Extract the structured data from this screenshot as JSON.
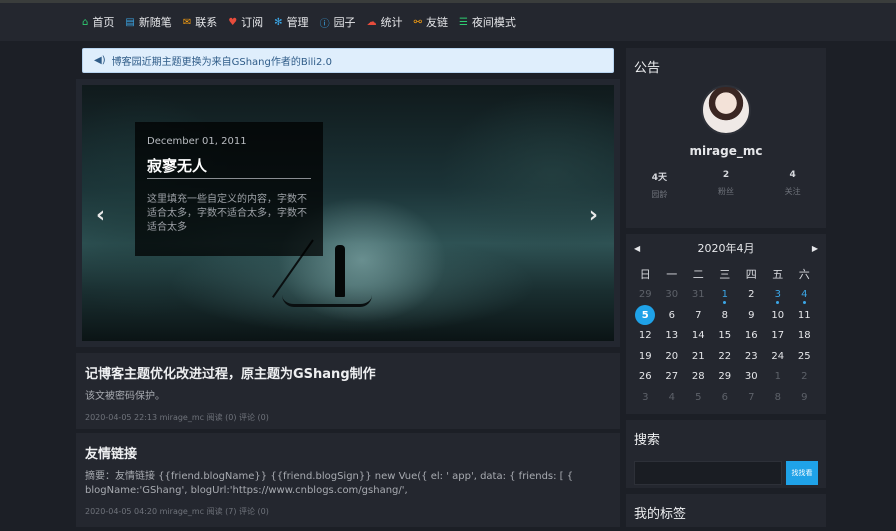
{
  "nav": {
    "items": [
      {
        "label": "首页",
        "icon": "home-icon",
        "color": "#2ecc71",
        "glyph": "⌂"
      },
      {
        "label": "新随笔",
        "icon": "document-icon",
        "color": "#3ba6e6",
        "glyph": "▤"
      },
      {
        "label": "联系",
        "icon": "mail-icon",
        "color": "#f39c12",
        "glyph": "✉"
      },
      {
        "label": "订阅",
        "icon": "heart-icon",
        "color": "#e74c3c",
        "glyph": "♥"
      },
      {
        "label": "管理",
        "icon": "gear-icon",
        "color": "#3ba6e6",
        "glyph": "✻"
      },
      {
        "label": "园子",
        "icon": "info-icon",
        "color": "#3ba6e6",
        "glyph": "ⓘ"
      },
      {
        "label": "统计",
        "icon": "cloud-icon",
        "color": "#e74c3c",
        "glyph": "☁"
      },
      {
        "label": "友链",
        "icon": "link-icon",
        "color": "#f39c12",
        "glyph": "⚯"
      },
      {
        "label": "夜间模式",
        "icon": "sliders-icon",
        "color": "#2ecc71",
        "glyph": "☰"
      }
    ]
  },
  "notice": {
    "icon": "speaker-icon",
    "text": "博客园近期主题更换为来自GShang作者的Bili2.0"
  },
  "carousel": {
    "date": "December 01, 2011",
    "title": "寂寥无人",
    "text": "这里填充一些自定义的内容，字数不适合太多，字数不适合太多，字数不适合太多",
    "prev": "‹",
    "next": "›"
  },
  "posts": [
    {
      "title": "记博客主题优化改进过程，原主题为GShang制作",
      "summary": "该文被密码保护。",
      "meta": "2020-04-05 22:13 mirage_mc 阅读 (0) 评论 (0)"
    },
    {
      "title": "友情链接",
      "summary": "摘要：友情链接 {{friend.blogName}} {{friend.blogSign}} new Vue({ el: ' app', data: { friends: [ { blogName:'GShang', blogUrl:'https://www.cnblogs.com/gshang/',",
      "meta": "2020-04-05 04:20 mirage_mc 阅读 (7) 评论 (0)"
    }
  ],
  "sidebar": {
    "announcement_title": "公告",
    "username": "mirage_mc",
    "stats": [
      {
        "value": "4天",
        "label": "园龄"
      },
      {
        "value": "2",
        "label": "粉丝"
      },
      {
        "value": "4",
        "label": "关注"
      }
    ],
    "calendar": {
      "month_label": "2020年4月",
      "prev": "◀",
      "next": "▶",
      "weekdays": [
        "日",
        "一",
        "二",
        "三",
        "四",
        "五",
        "六"
      ],
      "days": [
        {
          "d": "29",
          "t": "other"
        },
        {
          "d": "30",
          "t": "other"
        },
        {
          "d": "31",
          "t": "other"
        },
        {
          "d": "1",
          "t": "link"
        },
        {
          "d": "2",
          "t": ""
        },
        {
          "d": "3",
          "t": "link"
        },
        {
          "d": "4",
          "t": "link"
        },
        {
          "d": "5",
          "t": "today"
        },
        {
          "d": "6",
          "t": ""
        },
        {
          "d": "7",
          "t": ""
        },
        {
          "d": "8",
          "t": ""
        },
        {
          "d": "9",
          "t": ""
        },
        {
          "d": "10",
          "t": ""
        },
        {
          "d": "11",
          "t": ""
        },
        {
          "d": "12",
          "t": ""
        },
        {
          "d": "13",
          "t": ""
        },
        {
          "d": "14",
          "t": ""
        },
        {
          "d": "15",
          "t": ""
        },
        {
          "d": "16",
          "t": ""
        },
        {
          "d": "17",
          "t": ""
        },
        {
          "d": "18",
          "t": ""
        },
        {
          "d": "19",
          "t": ""
        },
        {
          "d": "20",
          "t": ""
        },
        {
          "d": "21",
          "t": ""
        },
        {
          "d": "22",
          "t": ""
        },
        {
          "d": "23",
          "t": ""
        },
        {
          "d": "24",
          "t": ""
        },
        {
          "d": "25",
          "t": ""
        },
        {
          "d": "26",
          "t": ""
        },
        {
          "d": "27",
          "t": ""
        },
        {
          "d": "28",
          "t": ""
        },
        {
          "d": "29",
          "t": ""
        },
        {
          "d": "30",
          "t": ""
        },
        {
          "d": "1",
          "t": "other"
        },
        {
          "d": "2",
          "t": "other"
        },
        {
          "d": "3",
          "t": "other"
        },
        {
          "d": "4",
          "t": "other"
        },
        {
          "d": "5",
          "t": "other"
        },
        {
          "d": "6",
          "t": "other"
        },
        {
          "d": "7",
          "t": "other"
        },
        {
          "d": "8",
          "t": "other"
        },
        {
          "d": "9",
          "t": "other"
        }
      ]
    },
    "search_title": "搜索",
    "search_value": "",
    "search_button": "找找看",
    "tags_title": "我的标签"
  }
}
